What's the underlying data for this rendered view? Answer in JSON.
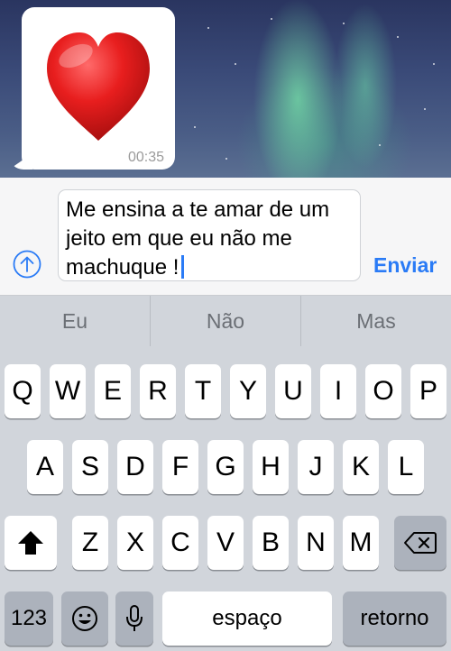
{
  "chat": {
    "message": {
      "type": "emoji",
      "emoji": "red-heart",
      "time": "00:35"
    }
  },
  "composer": {
    "text_lines": [
      "Me ensina a te amar de um",
      "jeito em que eu não me",
      "machuque !"
    ],
    "send_label": "Enviar"
  },
  "suggestions": [
    "Eu",
    "Não",
    "Mas"
  ],
  "keyboard": {
    "row1": [
      "Q",
      "W",
      "E",
      "R",
      "T",
      "Y",
      "U",
      "I",
      "O",
      "P"
    ],
    "row2": [
      "A",
      "S",
      "D",
      "F",
      "G",
      "H",
      "J",
      "K",
      "L"
    ],
    "row3": [
      "Z",
      "X",
      "C",
      "V",
      "B",
      "N",
      "M"
    ],
    "numbers_label": "123",
    "space_label": "espaço",
    "return_label": "retorno"
  },
  "colors": {
    "accent": "#2a7bf6",
    "key_bg": "#ffffff",
    "keyboard_bg": "#d1d5db"
  }
}
